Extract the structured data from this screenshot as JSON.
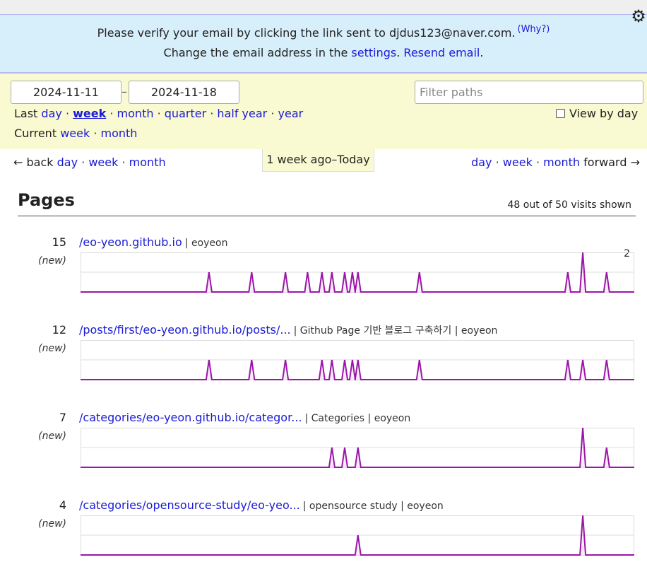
{
  "notice": {
    "verify_text": "Please verify your email by clicking the link sent to djdus123@naver.com.",
    "why_link": "(Why?)",
    "change_prefix": "Change the email address in the",
    "settings_link": "settings",
    "resend_link": "Resend email",
    "period": "."
  },
  "icons": {
    "gear": "gear-icon",
    "back_arrow": "←",
    "forward_arrow": "→"
  },
  "colors": {
    "accent": "#1a1ad6",
    "chart_line": "#9b16a8",
    "notice_bg": "#d7effb",
    "filter_bg": "#fafad2"
  },
  "filters": {
    "date_from": "2024-11-11",
    "date_sep": "–",
    "date_to": "2024-11-18",
    "filter_placeholder": "Filter paths",
    "last_label": "Last",
    "last_options": [
      "day",
      "week",
      "month",
      "quarter",
      "half year",
      "year"
    ],
    "current_label": "Current",
    "current_options": [
      "week",
      "month"
    ],
    "view_by_day": "View by day",
    "view_by_day_checked": false
  },
  "nav": {
    "back_label": "back",
    "forward_label": "forward",
    "steps": [
      "day",
      "week",
      "month"
    ],
    "period_label": "1 week ago–Today"
  },
  "pages": {
    "heading": "Pages",
    "shown_text": "48 out of 50 visits shown",
    "new_label": "(new)",
    "rows": [
      {
        "count": "15",
        "path": "/eo-yeon.github.io",
        "title": "| eoyeon",
        "peak_label": "2",
        "spikes": [
          [
            0.232,
            1
          ],
          [
            0.309,
            1
          ],
          [
            0.37,
            1
          ],
          [
            0.41,
            1
          ],
          [
            0.436,
            1
          ],
          [
            0.454,
            1
          ],
          [
            0.477,
            1
          ],
          [
            0.491,
            1
          ],
          [
            0.501,
            1
          ],
          [
            0.612,
            1
          ],
          [
            0.88,
            1
          ],
          [
            0.907,
            2
          ],
          [
            0.95,
            1
          ]
        ]
      },
      {
        "count": "12",
        "path": "/posts/first/eo-yeon.github.io/posts/...",
        "title": "| Github Page 기반 블로그 구축하기 | eoyeon",
        "peak_label": "",
        "spikes": [
          [
            0.232,
            1
          ],
          [
            0.309,
            1
          ],
          [
            0.37,
            1
          ],
          [
            0.436,
            1
          ],
          [
            0.454,
            1
          ],
          [
            0.477,
            1
          ],
          [
            0.491,
            1
          ],
          [
            0.501,
            1
          ],
          [
            0.612,
            1
          ],
          [
            0.88,
            1
          ],
          [
            0.907,
            1
          ],
          [
            0.95,
            1
          ]
        ]
      },
      {
        "count": "7",
        "path": "/categories/eo-yeon.github.io/categor...",
        "title": "| Categories | eoyeon",
        "peak_label": "",
        "spikes": [
          [
            0.454,
            1
          ],
          [
            0.477,
            1
          ],
          [
            0.501,
            1
          ],
          [
            0.907,
            2
          ],
          [
            0.95,
            1
          ]
        ]
      },
      {
        "count": "4",
        "path": "/categories/opensource-study/eo-yeo...",
        "title": "| opensource study | eoyeon",
        "peak_label": "",
        "spikes": [
          [
            0.501,
            1
          ],
          [
            0.907,
            2
          ]
        ]
      }
    ]
  }
}
